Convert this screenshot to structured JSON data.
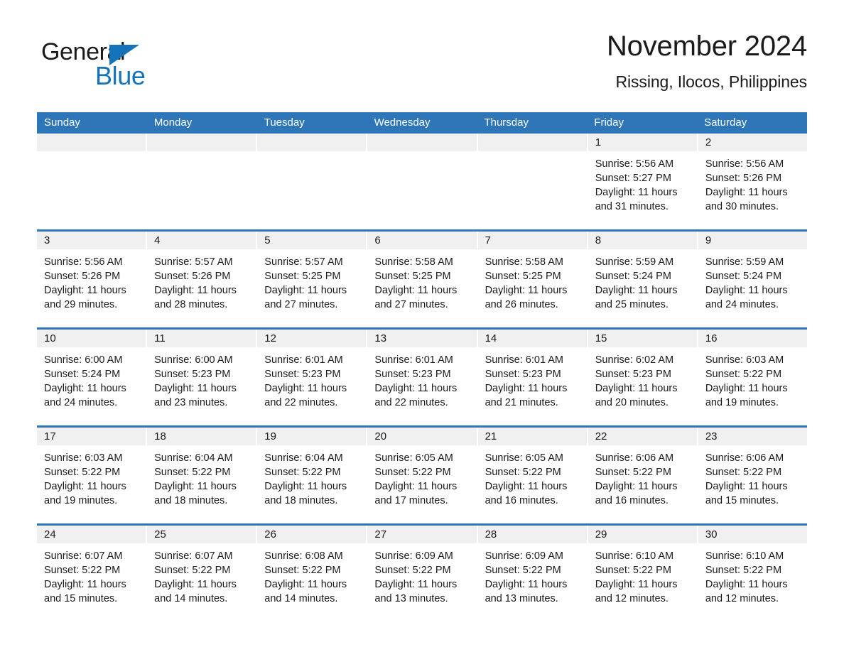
{
  "brand": {
    "name_part1": "General",
    "name_part2": "Blue",
    "accent_color": "#1473ba"
  },
  "header": {
    "title": "November 2024",
    "subtitle": "Rissing, Ilocos, Philippines",
    "header_bg_color": "#2e76b8",
    "date_band_color": "#f0f0f0"
  },
  "weekdays": [
    "Sunday",
    "Monday",
    "Tuesday",
    "Wednesday",
    "Thursday",
    "Friday",
    "Saturday"
  ],
  "weeks": [
    [
      {
        "day": "",
        "sunrise": "",
        "sunset": "",
        "daylight1": "",
        "daylight2": ""
      },
      {
        "day": "",
        "sunrise": "",
        "sunset": "",
        "daylight1": "",
        "daylight2": ""
      },
      {
        "day": "",
        "sunrise": "",
        "sunset": "",
        "daylight1": "",
        "daylight2": ""
      },
      {
        "day": "",
        "sunrise": "",
        "sunset": "",
        "daylight1": "",
        "daylight2": ""
      },
      {
        "day": "",
        "sunrise": "",
        "sunset": "",
        "daylight1": "",
        "daylight2": ""
      },
      {
        "day": "1",
        "sunrise": "Sunrise: 5:56 AM",
        "sunset": "Sunset: 5:27 PM",
        "daylight1": "Daylight: 11 hours",
        "daylight2": "and 31 minutes."
      },
      {
        "day": "2",
        "sunrise": "Sunrise: 5:56 AM",
        "sunset": "Sunset: 5:26 PM",
        "daylight1": "Daylight: 11 hours",
        "daylight2": "and 30 minutes."
      }
    ],
    [
      {
        "day": "3",
        "sunrise": "Sunrise: 5:56 AM",
        "sunset": "Sunset: 5:26 PM",
        "daylight1": "Daylight: 11 hours",
        "daylight2": "and 29 minutes."
      },
      {
        "day": "4",
        "sunrise": "Sunrise: 5:57 AM",
        "sunset": "Sunset: 5:26 PM",
        "daylight1": "Daylight: 11 hours",
        "daylight2": "and 28 minutes."
      },
      {
        "day": "5",
        "sunrise": "Sunrise: 5:57 AM",
        "sunset": "Sunset: 5:25 PM",
        "daylight1": "Daylight: 11 hours",
        "daylight2": "and 27 minutes."
      },
      {
        "day": "6",
        "sunrise": "Sunrise: 5:58 AM",
        "sunset": "Sunset: 5:25 PM",
        "daylight1": "Daylight: 11 hours",
        "daylight2": "and 27 minutes."
      },
      {
        "day": "7",
        "sunrise": "Sunrise: 5:58 AM",
        "sunset": "Sunset: 5:25 PM",
        "daylight1": "Daylight: 11 hours",
        "daylight2": "and 26 minutes."
      },
      {
        "day": "8",
        "sunrise": "Sunrise: 5:59 AM",
        "sunset": "Sunset: 5:24 PM",
        "daylight1": "Daylight: 11 hours",
        "daylight2": "and 25 minutes."
      },
      {
        "day": "9",
        "sunrise": "Sunrise: 5:59 AM",
        "sunset": "Sunset: 5:24 PM",
        "daylight1": "Daylight: 11 hours",
        "daylight2": "and 24 minutes."
      }
    ],
    [
      {
        "day": "10",
        "sunrise": "Sunrise: 6:00 AM",
        "sunset": "Sunset: 5:24 PM",
        "daylight1": "Daylight: 11 hours",
        "daylight2": "and 24 minutes."
      },
      {
        "day": "11",
        "sunrise": "Sunrise: 6:00 AM",
        "sunset": "Sunset: 5:23 PM",
        "daylight1": "Daylight: 11 hours",
        "daylight2": "and 23 minutes."
      },
      {
        "day": "12",
        "sunrise": "Sunrise: 6:01 AM",
        "sunset": "Sunset: 5:23 PM",
        "daylight1": "Daylight: 11 hours",
        "daylight2": "and 22 minutes."
      },
      {
        "day": "13",
        "sunrise": "Sunrise: 6:01 AM",
        "sunset": "Sunset: 5:23 PM",
        "daylight1": "Daylight: 11 hours",
        "daylight2": "and 22 minutes."
      },
      {
        "day": "14",
        "sunrise": "Sunrise: 6:01 AM",
        "sunset": "Sunset: 5:23 PM",
        "daylight1": "Daylight: 11 hours",
        "daylight2": "and 21 minutes."
      },
      {
        "day": "15",
        "sunrise": "Sunrise: 6:02 AM",
        "sunset": "Sunset: 5:23 PM",
        "daylight1": "Daylight: 11 hours",
        "daylight2": "and 20 minutes."
      },
      {
        "day": "16",
        "sunrise": "Sunrise: 6:03 AM",
        "sunset": "Sunset: 5:22 PM",
        "daylight1": "Daylight: 11 hours",
        "daylight2": "and 19 minutes."
      }
    ],
    [
      {
        "day": "17",
        "sunrise": "Sunrise: 6:03 AM",
        "sunset": "Sunset: 5:22 PM",
        "daylight1": "Daylight: 11 hours",
        "daylight2": "and 19 minutes."
      },
      {
        "day": "18",
        "sunrise": "Sunrise: 6:04 AM",
        "sunset": "Sunset: 5:22 PM",
        "daylight1": "Daylight: 11 hours",
        "daylight2": "and 18 minutes."
      },
      {
        "day": "19",
        "sunrise": "Sunrise: 6:04 AM",
        "sunset": "Sunset: 5:22 PM",
        "daylight1": "Daylight: 11 hours",
        "daylight2": "and 18 minutes."
      },
      {
        "day": "20",
        "sunrise": "Sunrise: 6:05 AM",
        "sunset": "Sunset: 5:22 PM",
        "daylight1": "Daylight: 11 hours",
        "daylight2": "and 17 minutes."
      },
      {
        "day": "21",
        "sunrise": "Sunrise: 6:05 AM",
        "sunset": "Sunset: 5:22 PM",
        "daylight1": "Daylight: 11 hours",
        "daylight2": "and 16 minutes."
      },
      {
        "day": "22",
        "sunrise": "Sunrise: 6:06 AM",
        "sunset": "Sunset: 5:22 PM",
        "daylight1": "Daylight: 11 hours",
        "daylight2": "and 16 minutes."
      },
      {
        "day": "23",
        "sunrise": "Sunrise: 6:06 AM",
        "sunset": "Sunset: 5:22 PM",
        "daylight1": "Daylight: 11 hours",
        "daylight2": "and 15 minutes."
      }
    ],
    [
      {
        "day": "24",
        "sunrise": "Sunrise: 6:07 AM",
        "sunset": "Sunset: 5:22 PM",
        "daylight1": "Daylight: 11 hours",
        "daylight2": "and 15 minutes."
      },
      {
        "day": "25",
        "sunrise": "Sunrise: 6:07 AM",
        "sunset": "Sunset: 5:22 PM",
        "daylight1": "Daylight: 11 hours",
        "daylight2": "and 14 minutes."
      },
      {
        "day": "26",
        "sunrise": "Sunrise: 6:08 AM",
        "sunset": "Sunset: 5:22 PM",
        "daylight1": "Daylight: 11 hours",
        "daylight2": "and 14 minutes."
      },
      {
        "day": "27",
        "sunrise": "Sunrise: 6:09 AM",
        "sunset": "Sunset: 5:22 PM",
        "daylight1": "Daylight: 11 hours",
        "daylight2": "and 13 minutes."
      },
      {
        "day": "28",
        "sunrise": "Sunrise: 6:09 AM",
        "sunset": "Sunset: 5:22 PM",
        "daylight1": "Daylight: 11 hours",
        "daylight2": "and 13 minutes."
      },
      {
        "day": "29",
        "sunrise": "Sunrise: 6:10 AM",
        "sunset": "Sunset: 5:22 PM",
        "daylight1": "Daylight: 11 hours",
        "daylight2": "and 12 minutes."
      },
      {
        "day": "30",
        "sunrise": "Sunrise: 6:10 AM",
        "sunset": "Sunset: 5:22 PM",
        "daylight1": "Daylight: 11 hours",
        "daylight2": "and 12 minutes."
      }
    ]
  ]
}
